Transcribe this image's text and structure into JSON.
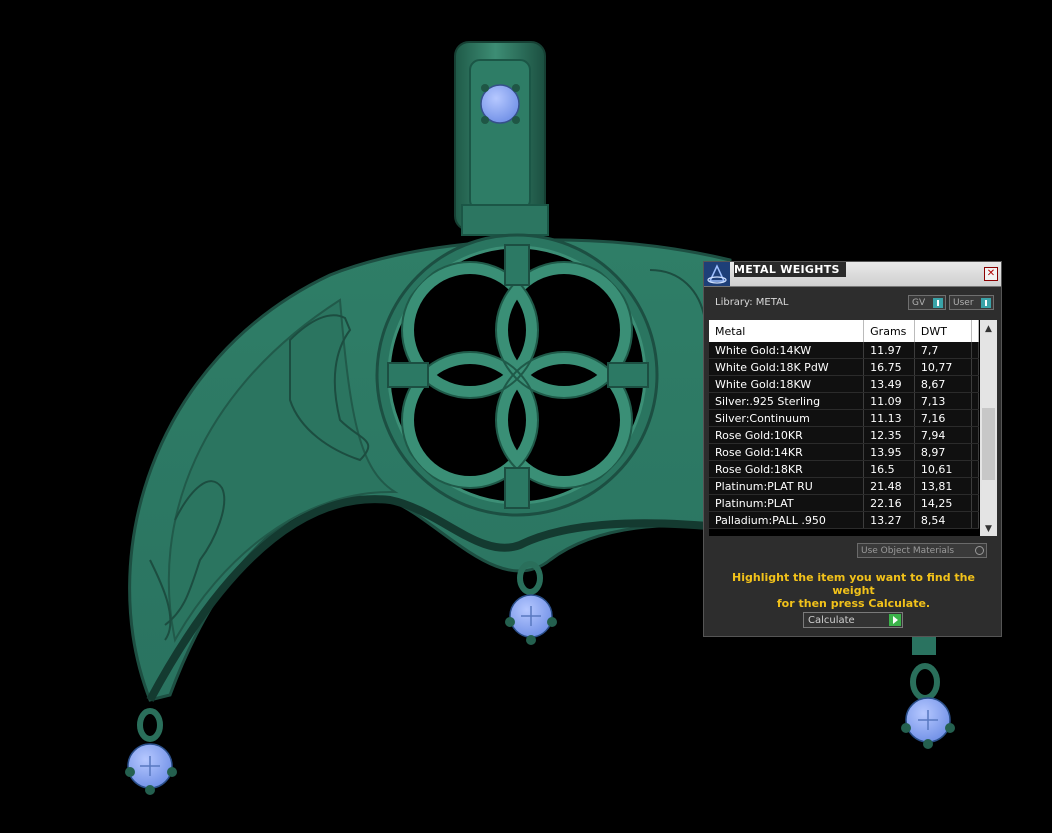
{
  "dialog": {
    "title": "METAL WEIGHTS",
    "close_glyph": "✕",
    "library_label": "Library: METAL",
    "gv_label": "GV",
    "user_label": "User",
    "columns": [
      "Metal",
      "Grams",
      "DWT"
    ],
    "rows": [
      {
        "metal": "White Gold:14KW",
        "grams": "11.97",
        "dwt": "7,7"
      },
      {
        "metal": "White Gold:18K PdW",
        "grams": "16.75",
        "dwt": "10,77"
      },
      {
        "metal": "White Gold:18KW",
        "grams": "13.49",
        "dwt": "8,67"
      },
      {
        "metal": "Silver:.925 Sterling",
        "grams": "11.09",
        "dwt": "7,13"
      },
      {
        "metal": "Silver:Continuum",
        "grams": "11.13",
        "dwt": "7,16"
      },
      {
        "metal": "Rose Gold:10KR",
        "grams": "12.35",
        "dwt": "7,94"
      },
      {
        "metal": "Rose Gold:14KR",
        "grams": "13.95",
        "dwt": "8,97"
      },
      {
        "metal": "Rose Gold:18KR",
        "grams": "16.5",
        "dwt": "10,61"
      },
      {
        "metal": "Platinum:PLAT RU",
        "grams": "21.48",
        "dwt": "13,81"
      },
      {
        "metal": "Platinum:PLAT",
        "grams": "22.16",
        "dwt": "14,25"
      },
      {
        "metal": "Palladium:PALL .950",
        "grams": "13.27",
        "dwt": "8,54"
      }
    ],
    "use_object_materials_label": "Use Object Materials",
    "hint_line1": "Highlight the item you want to find the weight",
    "hint_line2": "for then press Calculate.",
    "calculate_label": "Calculate"
  },
  "colors": {
    "background": "#000000",
    "pendant_metal": "#2f7a63",
    "gem": "#8aa8f0",
    "hint_text": "#f2c21a",
    "calc_go": "#3bb34a",
    "toggle_indicator": "#39a3a8"
  }
}
